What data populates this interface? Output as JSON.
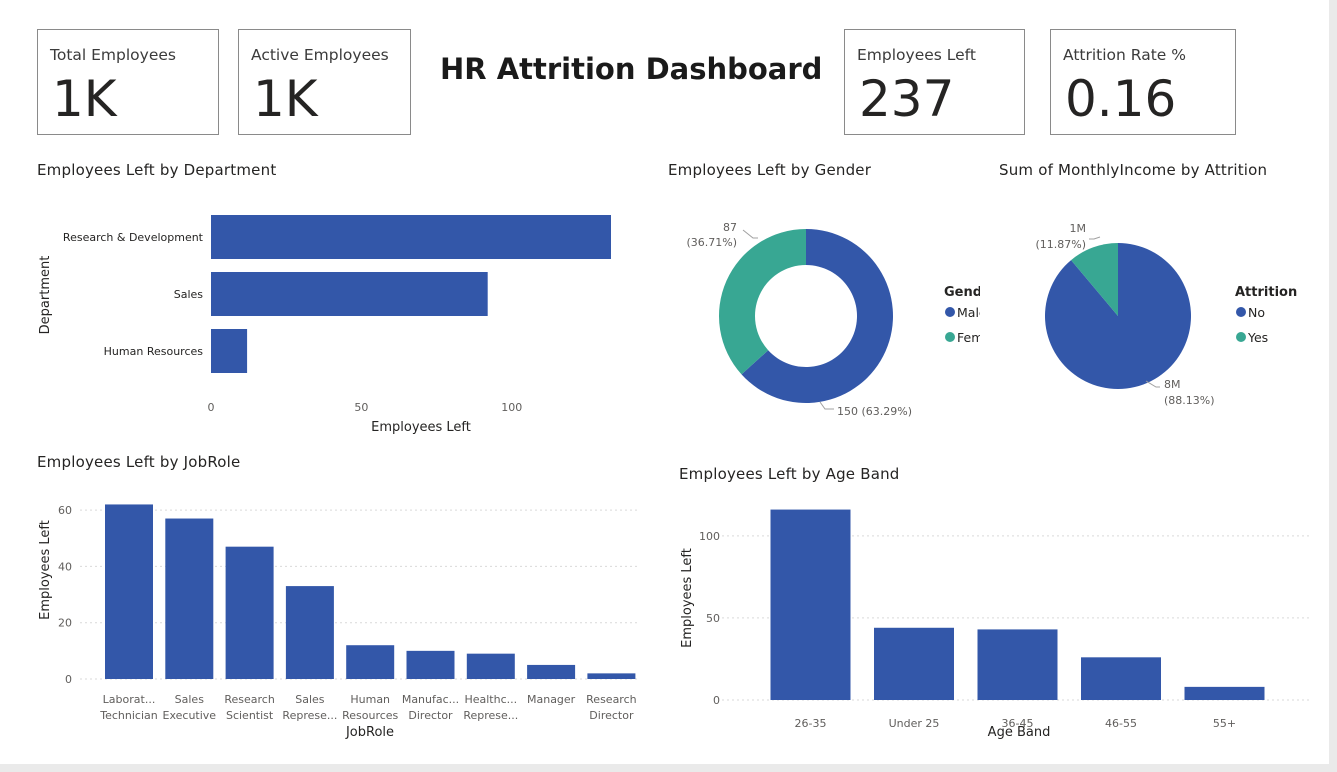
{
  "dashboard_title": "HR Attrition Dashboard",
  "kpis": [
    {
      "label": "Total Employees",
      "value": "1K"
    },
    {
      "label": "Active Employees",
      "value": "1K"
    },
    {
      "label": "Employees Left",
      "value": "237"
    },
    {
      "label": "Attrition Rate %",
      "value": "0.16"
    }
  ],
  "colors": {
    "primary": "#3357a9",
    "secondary": "#38a793",
    "gridline": "#d9d9d9",
    "card_border": "#8a8a8a"
  },
  "chart_data": [
    {
      "type": "bar",
      "orientation": "horizontal",
      "title": "Employees Left by Department",
      "xlabel": "Employees Left",
      "ylabel": "Department",
      "categories": [
        "Research & Development",
        "Sales",
        "Human Resources"
      ],
      "values": [
        133,
        92,
        12
      ],
      "xlim": [
        0,
        133
      ],
      "xticks": [
        "0",
        "50",
        "100"
      ],
      "grid": false
    },
    {
      "type": "pie",
      "donut": true,
      "title": "Employees Left by Gender",
      "legend_title": "Gender",
      "legend_position": "right",
      "slices": [
        {
          "label": "Male",
          "value": 150,
          "percent": "63.29%",
          "data_label": "150 (63.29%)",
          "color": "#3357a9"
        },
        {
          "label": "Femal",
          "value": 87,
          "percent": "36.71%",
          "data_label": "87",
          "data_label_pct": "(36.71%)",
          "color": "#38a793"
        }
      ]
    },
    {
      "type": "pie",
      "donut": false,
      "title": "Sum of MonthlyIncome by Attrition",
      "legend_title": "Attrition",
      "legend_position": "right",
      "slices": [
        {
          "label": "No",
          "value": 8,
          "percent": "88.13%",
          "data_label": "8M",
          "data_label_pct": "(88.13%)",
          "color": "#3357a9"
        },
        {
          "label": "Yes",
          "value": 1,
          "percent": "11.87%",
          "data_label": "1M",
          "data_label_pct": "(11.87%)",
          "color": "#38a793"
        }
      ]
    },
    {
      "type": "bar",
      "orientation": "vertical",
      "title": "Employees Left by JobRole",
      "xlabel": "JobRole",
      "ylabel": "Employees Left",
      "categories": [
        [
          "Laborat...",
          "Technician"
        ],
        [
          "Sales",
          "Executive"
        ],
        [
          "Research",
          "Scientist"
        ],
        [
          "Sales",
          "Represe..."
        ],
        [
          "Human",
          "Resources"
        ],
        [
          "Manufac...",
          "Director"
        ],
        [
          "Healthc...",
          "Represe..."
        ],
        [
          "Manager"
        ],
        [
          "Research",
          "Director"
        ]
      ],
      "values": [
        62,
        57,
        47,
        33,
        12,
        10,
        9,
        5,
        2
      ],
      "ylim": [
        0,
        65
      ],
      "yticks": [
        0,
        20,
        40,
        60
      ],
      "grid": true
    },
    {
      "type": "bar",
      "orientation": "vertical",
      "title": "Employees Left by Age Band",
      "xlabel": "Age Band",
      "ylabel": "Employees Left",
      "categories": [
        "26-35",
        "Under 25",
        "36-45",
        "46-55",
        "55+"
      ],
      "values": [
        116,
        44,
        43,
        26,
        8
      ],
      "ylim": [
        0,
        120
      ],
      "yticks": [
        0,
        50,
        100
      ],
      "grid": true
    }
  ]
}
